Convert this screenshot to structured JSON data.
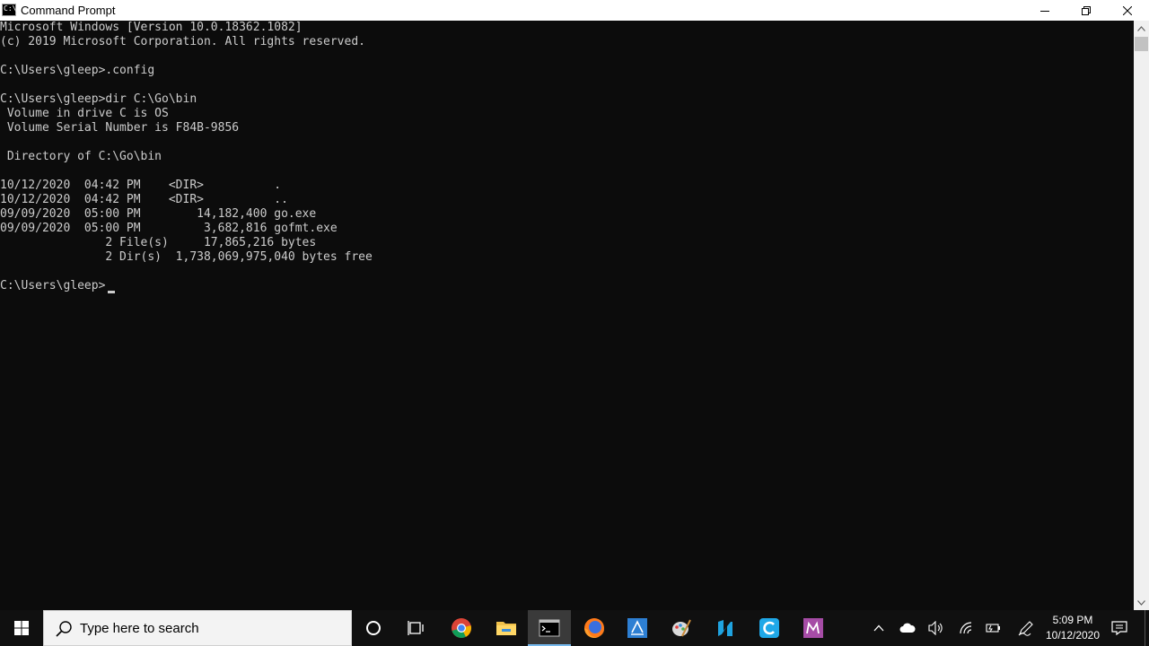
{
  "window": {
    "title": "Command Prompt",
    "icon_text": "C:\\"
  },
  "console": {
    "lines": [
      "Microsoft Windows [Version 10.0.18362.1082]",
      "(c) 2019 Microsoft Corporation. All rights reserved.",
      "",
      "C:\\Users\\gleep>.config",
      "",
      "C:\\Users\\gleep>dir C:\\Go\\bin",
      " Volume in drive C is OS",
      " Volume Serial Number is F84B-9856",
      "",
      " Directory of C:\\Go\\bin",
      "",
      "10/12/2020  04:42 PM    <DIR>          .",
      "10/12/2020  04:42 PM    <DIR>          ..",
      "09/09/2020  05:00 PM        14,182,400 go.exe",
      "09/09/2020  05:00 PM         3,682,816 gofmt.exe",
      "               2 File(s)     17,865,216 bytes",
      "               2 Dir(s)  1,738,069,975,040 bytes free",
      "",
      "C:\\Users\\gleep>"
    ]
  },
  "taskbar": {
    "search_placeholder": "Type here to search",
    "pinned_icons": [
      "cortana-icon",
      "task-view-icon",
      "chrome-icon",
      "file-explorer-icon",
      "command-prompt-icon",
      "firefox-icon",
      "app-blue-icon",
      "paint-icon",
      "app-n-icon",
      "app-c-icon",
      "app-m-icon"
    ],
    "clock_time": "5:09 PM",
    "clock_date": "10/12/2020"
  },
  "colors": {
    "console_bg": "#0c0c0c",
    "console_fg": "#cccccc",
    "taskbar_bg": "#101010",
    "accent": "#76b9ed"
  }
}
